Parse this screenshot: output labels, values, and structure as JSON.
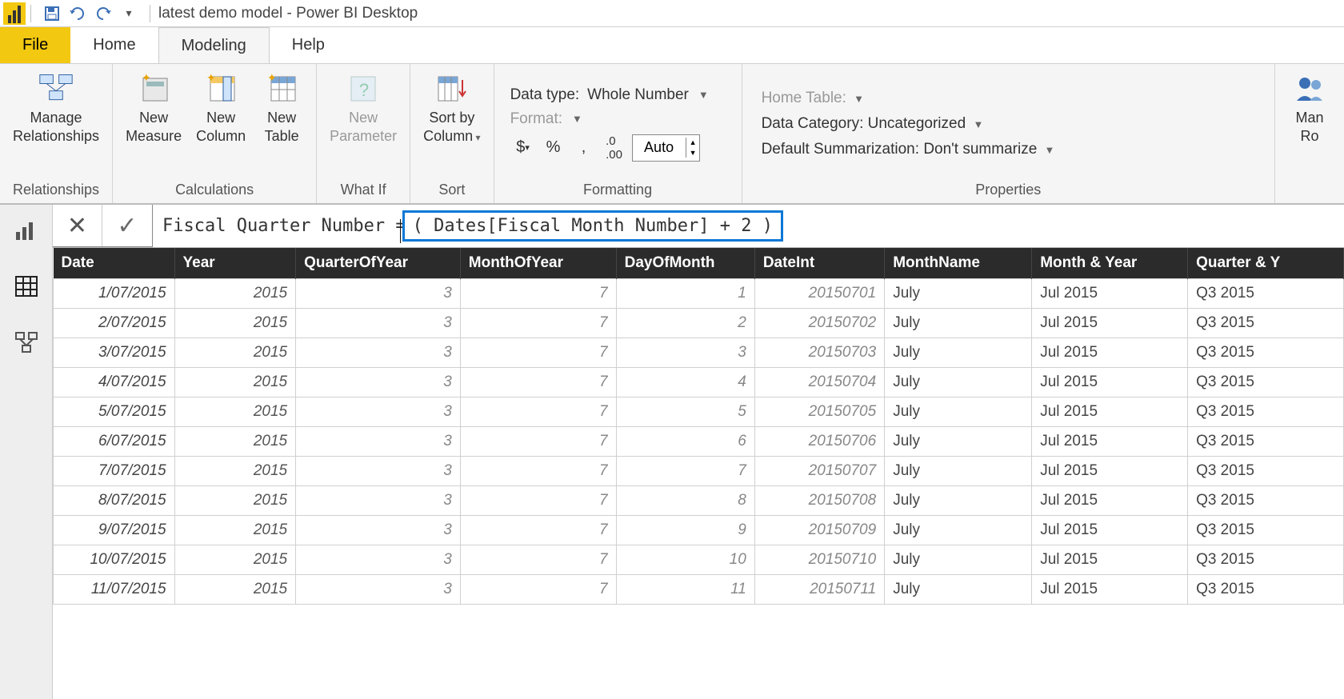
{
  "titlebar": {
    "app_title": "latest demo model - Power BI Desktop"
  },
  "menu": {
    "file": "File",
    "home": "Home",
    "modeling": "Modeling",
    "help": "Help"
  },
  "ribbon": {
    "relationships": {
      "manage": "Manage\nRelationships",
      "group": "Relationships"
    },
    "calculations": {
      "new_measure": "New\nMeasure",
      "new_column": "New\nColumn",
      "new_table": "New\nTable",
      "group": "Calculations"
    },
    "whatif": {
      "new_parameter": "New\nParameter",
      "group": "What If"
    },
    "sort": {
      "sort_by": "Sort by\nColumn",
      "group": "Sort"
    },
    "formatting": {
      "data_type_label": "Data type:",
      "data_type_value": "Whole Number",
      "format_label": "Format:",
      "auto_value": "Auto",
      "group": "Formatting"
    },
    "properties": {
      "home_table_label": "Home Table:",
      "data_category_label": "Data Category:",
      "data_category_value": "Uncategorized",
      "default_summ_label": "Default Summarization:",
      "default_summ_value": "Don't summarize",
      "group": "Properties"
    },
    "security": {
      "manage_roles": "Man\nRo"
    }
  },
  "formula": {
    "lhs": "Fiscal Quarter Number = ",
    "rhs": "( Dates[Fiscal Month Number] + 2 )"
  },
  "columns": [
    "Date",
    "Year",
    "QuarterOfYear",
    "MonthOfYear",
    "DayOfMonth",
    "DateInt",
    "MonthName",
    "Month & Year",
    "Quarter & Y"
  ],
  "rows": [
    {
      "Date": "1/07/2015",
      "Year": "2015",
      "QuarterOfYear": "3",
      "MonthOfYear": "7",
      "DayOfMonth": "1",
      "DateInt": "20150701",
      "MonthName": "July",
      "MonthYear": "Jul 2015",
      "QuarterYear": "Q3 2015"
    },
    {
      "Date": "2/07/2015",
      "Year": "2015",
      "QuarterOfYear": "3",
      "MonthOfYear": "7",
      "DayOfMonth": "2",
      "DateInt": "20150702",
      "MonthName": "July",
      "MonthYear": "Jul 2015",
      "QuarterYear": "Q3 2015"
    },
    {
      "Date": "3/07/2015",
      "Year": "2015",
      "QuarterOfYear": "3",
      "MonthOfYear": "7",
      "DayOfMonth": "3",
      "DateInt": "20150703",
      "MonthName": "July",
      "MonthYear": "Jul 2015",
      "QuarterYear": "Q3 2015"
    },
    {
      "Date": "4/07/2015",
      "Year": "2015",
      "QuarterOfYear": "3",
      "MonthOfYear": "7",
      "DayOfMonth": "4",
      "DateInt": "20150704",
      "MonthName": "July",
      "MonthYear": "Jul 2015",
      "QuarterYear": "Q3 2015"
    },
    {
      "Date": "5/07/2015",
      "Year": "2015",
      "QuarterOfYear": "3",
      "MonthOfYear": "7",
      "DayOfMonth": "5",
      "DateInt": "20150705",
      "MonthName": "July",
      "MonthYear": "Jul 2015",
      "QuarterYear": "Q3 2015"
    },
    {
      "Date": "6/07/2015",
      "Year": "2015",
      "QuarterOfYear": "3",
      "MonthOfYear": "7",
      "DayOfMonth": "6",
      "DateInt": "20150706",
      "MonthName": "July",
      "MonthYear": "Jul 2015",
      "QuarterYear": "Q3 2015"
    },
    {
      "Date": "7/07/2015",
      "Year": "2015",
      "QuarterOfYear": "3",
      "MonthOfYear": "7",
      "DayOfMonth": "7",
      "DateInt": "20150707",
      "MonthName": "July",
      "MonthYear": "Jul 2015",
      "QuarterYear": "Q3 2015"
    },
    {
      "Date": "8/07/2015",
      "Year": "2015",
      "QuarterOfYear": "3",
      "MonthOfYear": "7",
      "DayOfMonth": "8",
      "DateInt": "20150708",
      "MonthName": "July",
      "MonthYear": "Jul 2015",
      "QuarterYear": "Q3 2015"
    },
    {
      "Date": "9/07/2015",
      "Year": "2015",
      "QuarterOfYear": "3",
      "MonthOfYear": "7",
      "DayOfMonth": "9",
      "DateInt": "20150709",
      "MonthName": "July",
      "MonthYear": "Jul 2015",
      "QuarterYear": "Q3 2015"
    },
    {
      "Date": "10/07/2015",
      "Year": "2015",
      "QuarterOfYear": "3",
      "MonthOfYear": "7",
      "DayOfMonth": "10",
      "DateInt": "20150710",
      "MonthName": "July",
      "MonthYear": "Jul 2015",
      "QuarterYear": "Q3 2015"
    },
    {
      "Date": "11/07/2015",
      "Year": "2015",
      "QuarterOfYear": "3",
      "MonthOfYear": "7",
      "DayOfMonth": "11",
      "DateInt": "20150711",
      "MonthName": "July",
      "MonthYear": "Jul 2015",
      "QuarterYear": "Q3 2015"
    }
  ]
}
